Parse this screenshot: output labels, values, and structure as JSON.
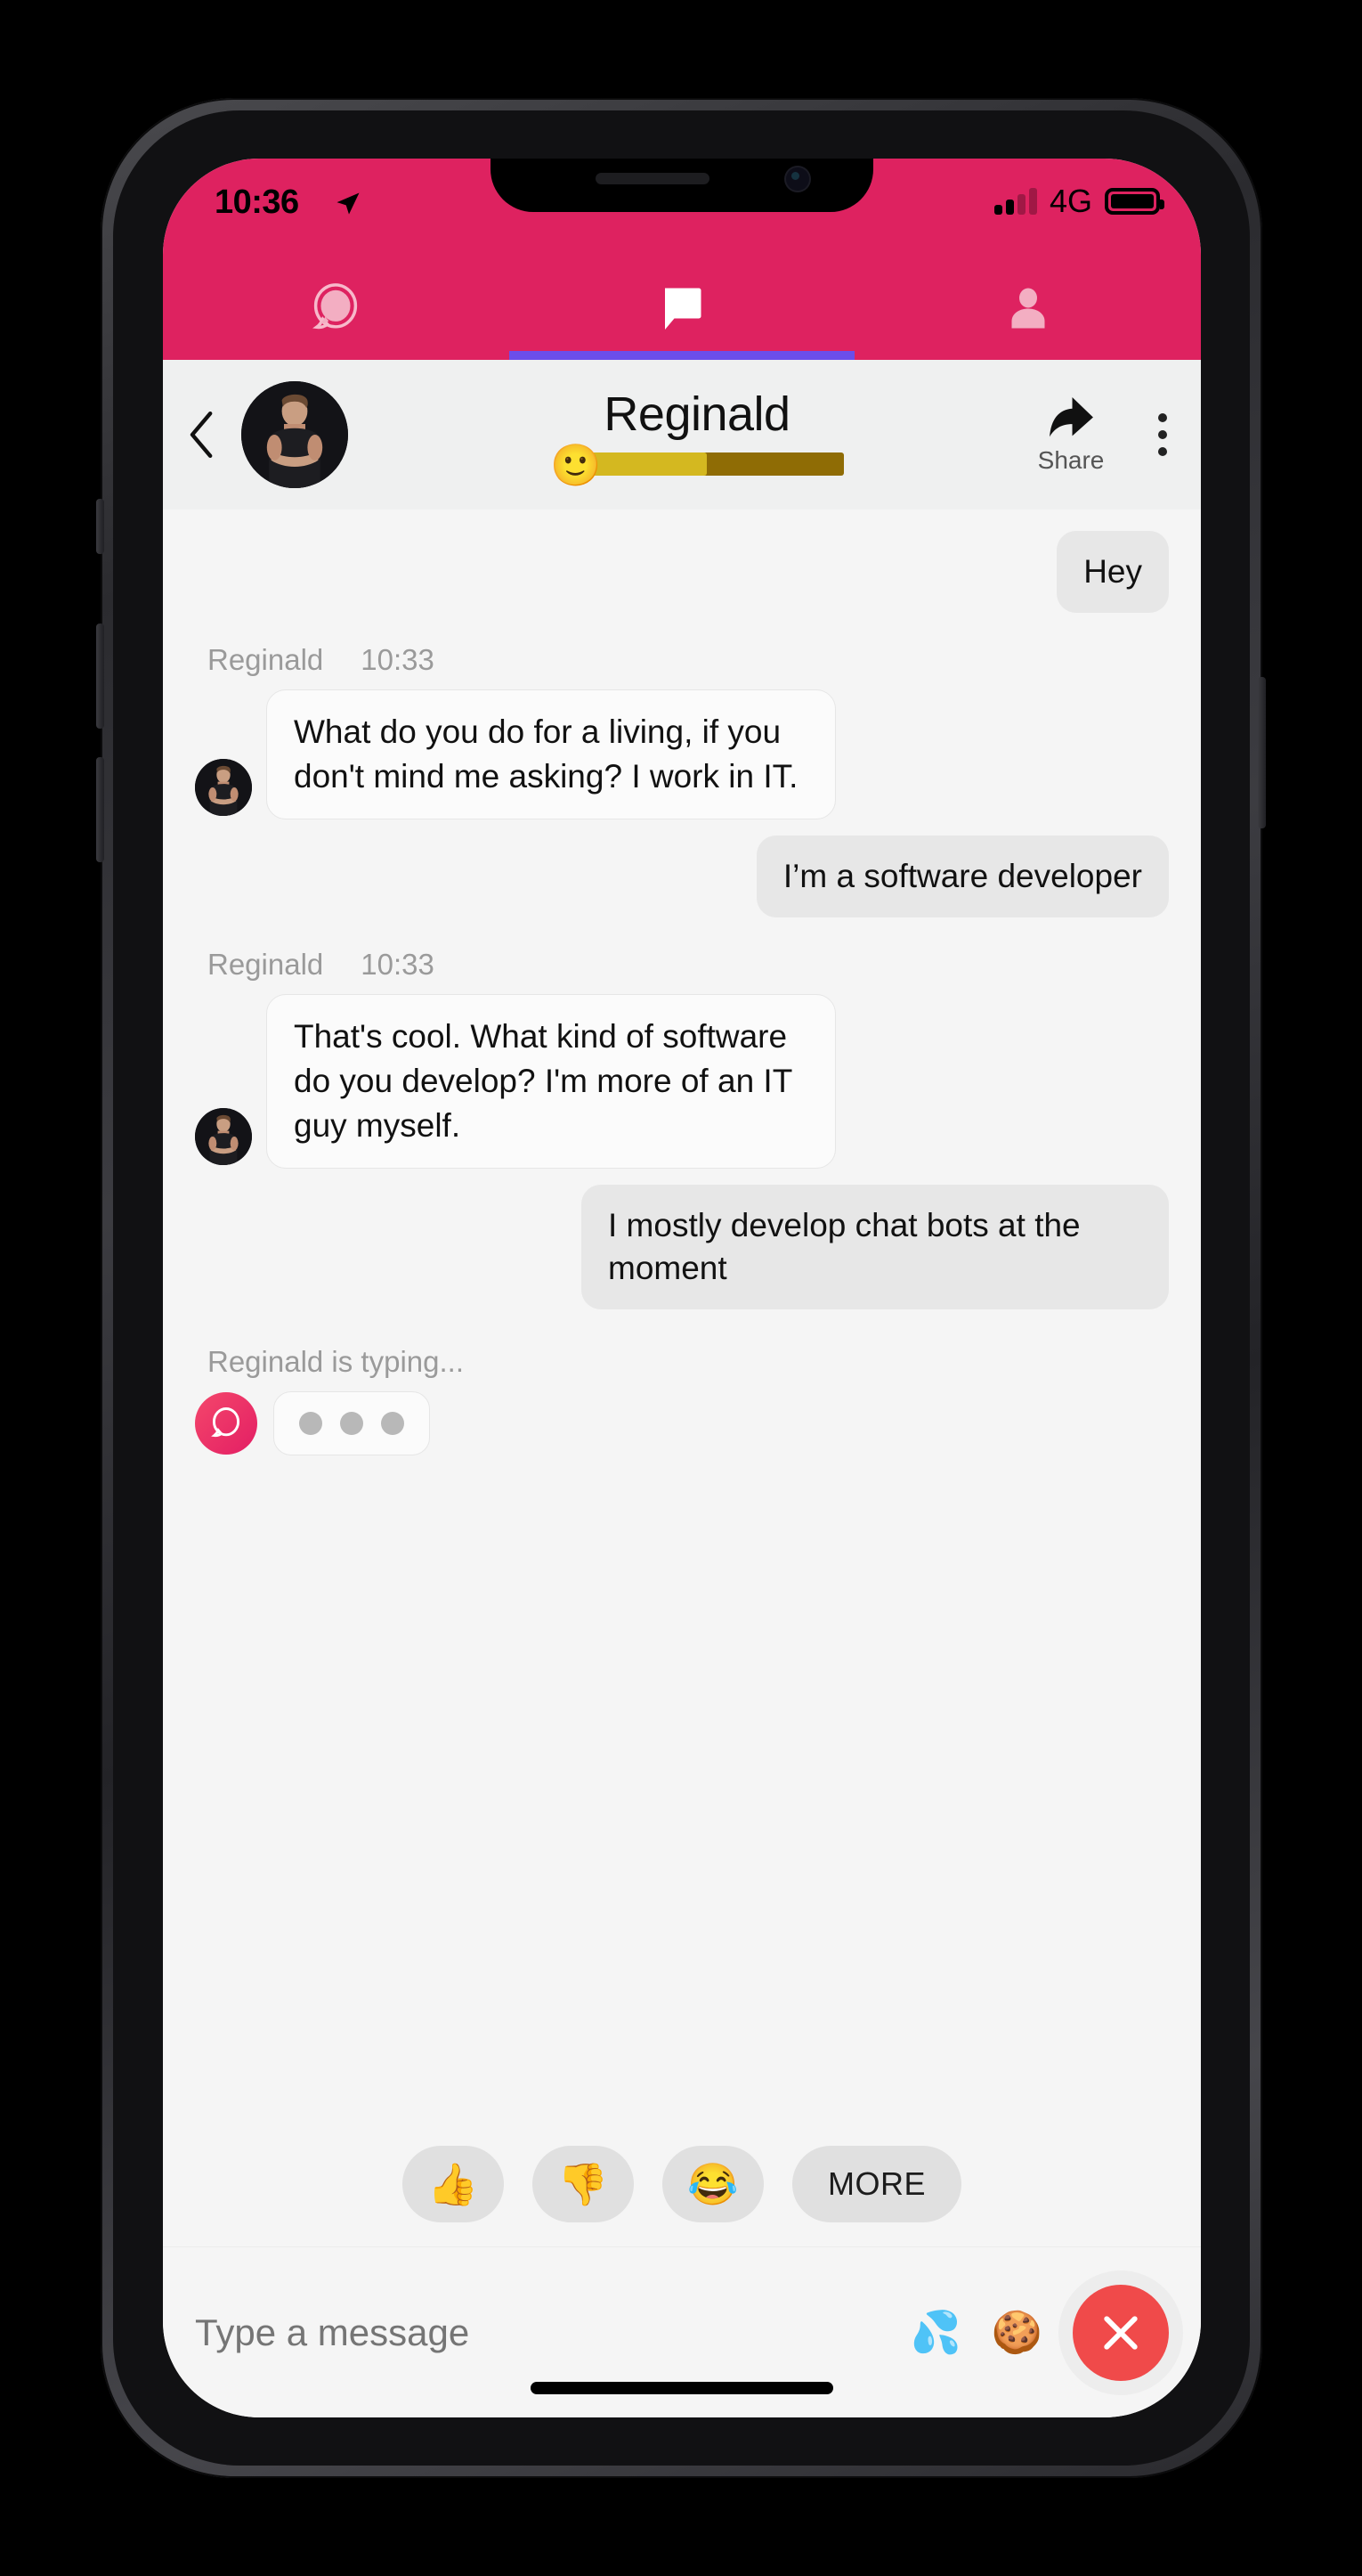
{
  "status_bar": {
    "time": "10:36",
    "location_icon": "location-arrow-icon",
    "signal_icon": "signal-bars-icon",
    "signal_bars_filled": 2,
    "signal_bars_total": 4,
    "network": "4G",
    "battery_icon": "battery-full-icon",
    "battery_level": 100
  },
  "theme": {
    "brand_pink": "#DE2260",
    "active_tab_indicator": "#6B4EEB",
    "close_button_red": "#F04A4A",
    "mood_bar_fill": "#d4b820",
    "mood_bar_track": "#8f6c05"
  },
  "tabs": [
    {
      "name": "discover",
      "icon": "speech-bubble-outline-icon",
      "active": false
    },
    {
      "name": "chats",
      "icon": "chat-bubble-filled-icon",
      "active": true
    },
    {
      "name": "profile",
      "icon": "person-icon",
      "active": false
    }
  ],
  "header": {
    "back_icon": "back-chevron-icon",
    "avatar": "contact-avatar",
    "name": "Reginald",
    "mood_emoji": "🙂",
    "mood_percent": 50,
    "share_icon": "share-arrow-icon",
    "share_label": "Share",
    "menu_icon": "overflow-menu-icon"
  },
  "conversation": [
    {
      "kind": "outgoing",
      "text": "Hey"
    },
    {
      "kind": "meta",
      "sender": "Reginald",
      "time": "10:33"
    },
    {
      "kind": "incoming",
      "text": "What do you do for a living, if you don't mind me asking? I work in IT."
    },
    {
      "kind": "outgoing",
      "text": "I’m a software developer"
    },
    {
      "kind": "meta",
      "sender": "Reginald",
      "time": "10:33"
    },
    {
      "kind": "incoming",
      "text": "That's cool. What kind of software do you develop? I'm more of an IT guy myself."
    },
    {
      "kind": "outgoing",
      "text": "I mostly develop chat bots at the moment"
    }
  ],
  "typing": {
    "label": "Reginald is typing...",
    "avatar_icon": "bot-bubble-icon"
  },
  "quick_reactions": [
    {
      "name": "thumbs-up",
      "emoji": "👍"
    },
    {
      "name": "thumbs-down",
      "emoji": "👎"
    },
    {
      "name": "joy",
      "emoji": "😂"
    }
  ],
  "more_label": "MORE",
  "input_bar": {
    "placeholder": "Type a message",
    "value": "",
    "emoji_shortcuts": [
      {
        "name": "sweat-droplets",
        "emoji": "💦"
      },
      {
        "name": "cookie",
        "emoji": "🍪"
      }
    ],
    "close_icon": "close-x-icon"
  }
}
